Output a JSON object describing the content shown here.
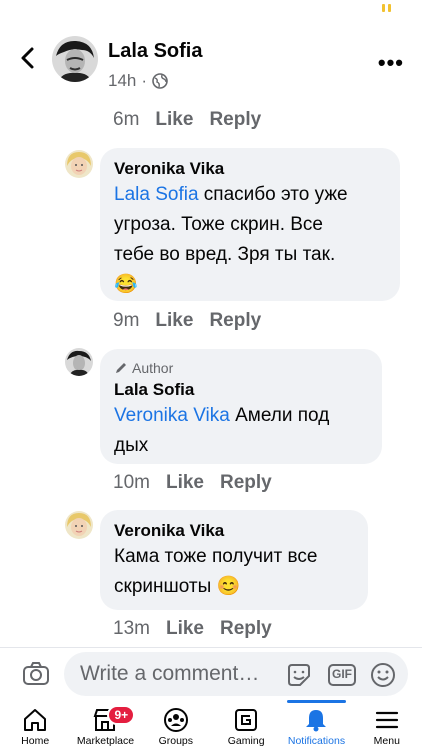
{
  "header": {
    "name": "Lala Sofia",
    "time": "14h",
    "dot": "·"
  },
  "first_actions": {
    "time": "6m",
    "like": "Like",
    "reply": "Reply"
  },
  "comments": [
    {
      "name": "Veronika Vika",
      "mention": "Lala Sofia",
      "text_line1": " спасибо это уже",
      "text_line2": "угроза. Тоже скрин. Все",
      "text_line3": "тебе во вред. Зря ты так.",
      "emoji": "😂",
      "time": "9m",
      "like": "Like",
      "reply": "Reply"
    },
    {
      "author_tag": "Author",
      "name": "Lala Sofia",
      "mention": "Veronika Vika",
      "text_line1": "  Амели под",
      "text_line2": "дых",
      "time": "10m",
      "like": "Like",
      "reply": "Reply"
    },
    {
      "name": "Veronika Vika",
      "text_line1": "Кама тоже получит все",
      "text_line2": "скриншоты ",
      "emoji": "😊",
      "time": "13m",
      "like": "Like",
      "reply": "Reply"
    }
  ],
  "composer": {
    "placeholder": "Write a comment…",
    "gif": "GIF"
  },
  "nav": {
    "items": [
      {
        "label": "Home",
        "icon": "home-icon"
      },
      {
        "label": "Marketplace",
        "icon": "marketplace-icon",
        "badge": "9+"
      },
      {
        "label": "Groups",
        "icon": "groups-icon"
      },
      {
        "label": "Gaming",
        "icon": "gaming-icon"
      },
      {
        "label": "Notifications",
        "icon": "bell-icon"
      },
      {
        "label": "Menu",
        "icon": "menu-icon"
      }
    ]
  },
  "colors": {
    "accent": "#1b74e4",
    "badge": "#e41e3f",
    "bubble": "#f0f2f5",
    "muted": "#65676b"
  }
}
